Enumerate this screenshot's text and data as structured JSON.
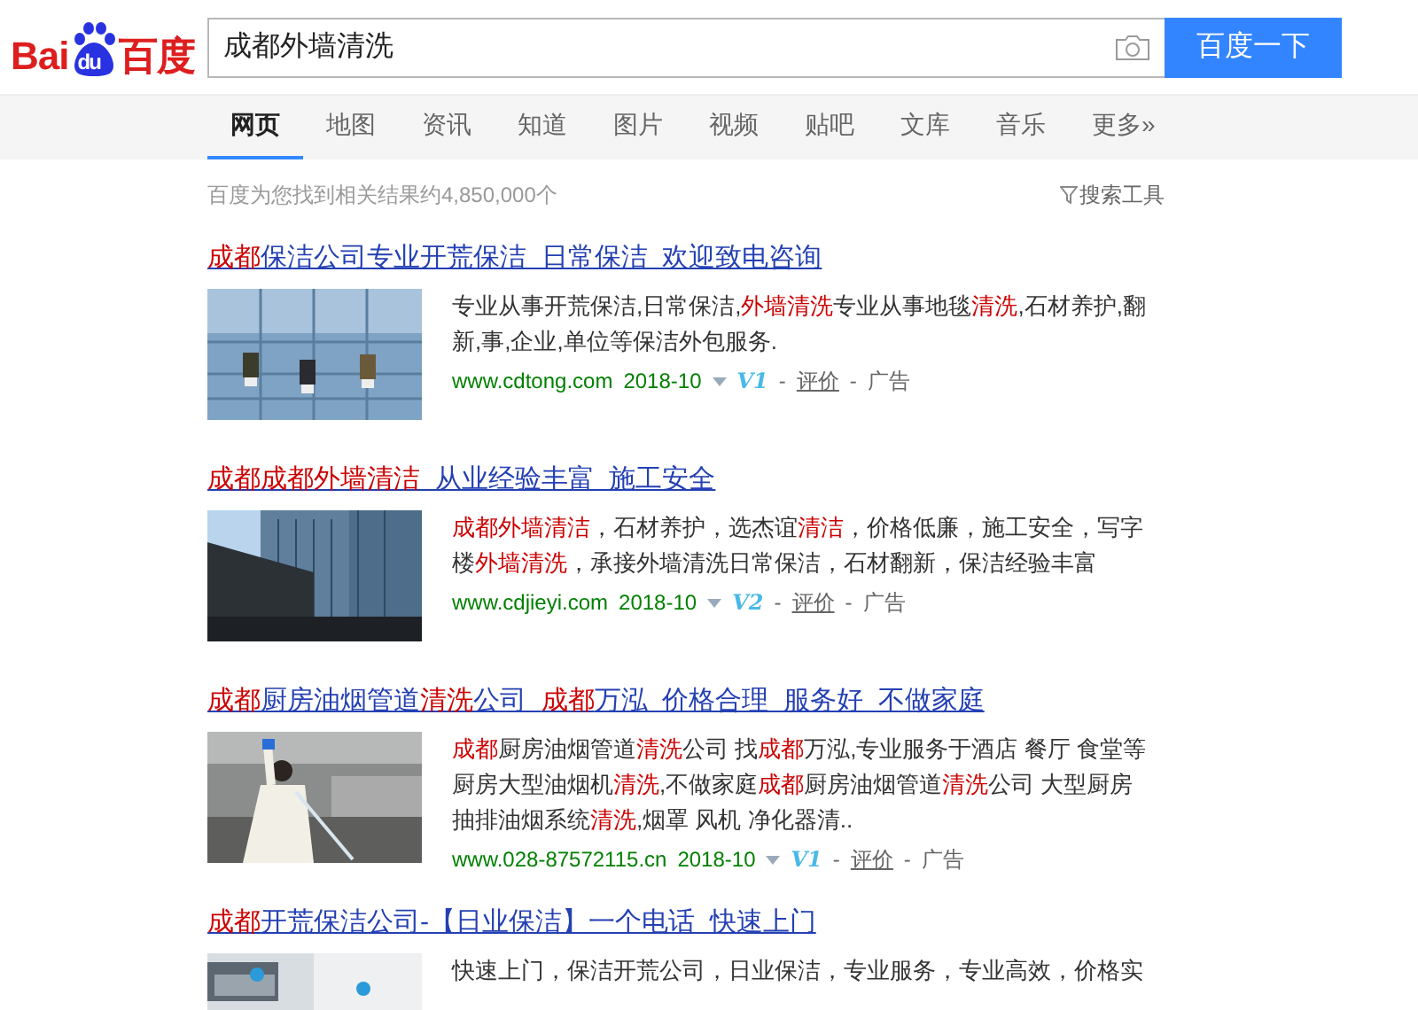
{
  "logo": {
    "left": "Bai",
    "paw": "du",
    "right": "百度"
  },
  "search": {
    "value": "成都外墙清洗",
    "button": "百度一下"
  },
  "tabs": [
    {
      "label": "网页",
      "selected": true
    },
    {
      "label": "地图",
      "selected": false
    },
    {
      "label": "资讯",
      "selected": false
    },
    {
      "label": "知道",
      "selected": false
    },
    {
      "label": "图片",
      "selected": false
    },
    {
      "label": "视频",
      "selected": false
    },
    {
      "label": "贴吧",
      "selected": false
    },
    {
      "label": "文库",
      "selected": false
    },
    {
      "label": "音乐",
      "selected": false
    },
    {
      "label": "更多»",
      "selected": false
    }
  ],
  "result_count": "百度为您找到相关结果约4,850,000个",
  "search_tools": "搜索工具",
  "results": [
    {
      "title": [
        {
          "text": "成都",
          "hit": true
        },
        {
          "text": "保洁公司专业开荒保洁  日常保洁  欢迎致电咨询",
          "hit": false
        }
      ],
      "description": [
        {
          "text": "专业从事开荒保洁,日常保洁,",
          "hit": false
        },
        {
          "text": "外墙清洗",
          "hit": true
        },
        {
          "text": "专业从事地毯",
          "hit": false
        },
        {
          "text": "清洗",
          "hit": true
        },
        {
          "text": ",石材养护,翻新,事,企业,单位等保洁外包服务.",
          "hit": false
        }
      ],
      "meta": {
        "url": "www.cdtong.com",
        "date": "2018-10",
        "badge": "V1",
        "sep_1": "-",
        "rating": "评价",
        "sep_2": "-",
        "ad": "广告"
      }
    },
    {
      "title": [
        {
          "text": "成都成都外墙清洁",
          "hit": true
        },
        {
          "text": "  从业经验丰富  施工安全",
          "hit": false
        }
      ],
      "description": [
        {
          "text": "成都外墙清洁",
          "hit": true
        },
        {
          "text": "，石材养护，选杰谊",
          "hit": false
        },
        {
          "text": "清洁",
          "hit": true
        },
        {
          "text": "，价格低廉，施工安全，写字楼",
          "hit": false
        },
        {
          "text": "外墙清洗",
          "hit": true
        },
        {
          "text": "，承接外墙清洗日常保洁，石材翻新，保洁经验丰富",
          "hit": false
        }
      ],
      "meta": {
        "url": "www.cdjieyi.com",
        "date": "2018-10",
        "badge": "V2",
        "sep_1": "-",
        "rating": "评价",
        "sep_2": "-",
        "ad": "广告"
      }
    },
    {
      "title": [
        {
          "text": "成都",
          "hit": true
        },
        {
          "text": "厨房油烟管道",
          "hit": false
        },
        {
          "text": "清洗",
          "hit": true
        },
        {
          "text": "公司  ",
          "hit": false
        },
        {
          "text": "成都",
          "hit": true
        },
        {
          "text": "万泓  价格合理  服务好  不做家庭",
          "hit": false
        }
      ],
      "description": [
        {
          "text": "成都",
          "hit": true
        },
        {
          "text": "厨房油烟管道",
          "hit": false
        },
        {
          "text": "清洗",
          "hit": true
        },
        {
          "text": "公司 找",
          "hit": false
        },
        {
          "text": "成都",
          "hit": true
        },
        {
          "text": "万泓,专业服务于酒店 餐厅 食堂等厨房大型油烟机",
          "hit": false
        },
        {
          "text": "清洗",
          "hit": true
        },
        {
          "text": ",不做家庭",
          "hit": false
        },
        {
          "text": "成都",
          "hit": true
        },
        {
          "text": "厨房油烟管道",
          "hit": false
        },
        {
          "text": "清洗",
          "hit": true
        },
        {
          "text": "公司 大型厨房抽排油烟系统",
          "hit": false
        },
        {
          "text": "清洗",
          "hit": true
        },
        {
          "text": ",烟罩 风机 净化器清..",
          "hit": false
        }
      ],
      "meta": {
        "url": "www.028-87572115.cn",
        "date": "2018-10",
        "badge": "V1",
        "sep_1": "-",
        "rating": "评价",
        "sep_2": "-",
        "ad": "广告"
      }
    },
    {
      "title": [
        {
          "text": "成都",
          "hit": true
        },
        {
          "text": "开荒保洁公司-【日业保洁】一个电话  快速上门",
          "hit": false
        }
      ],
      "description": [
        {
          "text": "快速上门，保洁开荒公司，日业保洁，专业服务，专业高效，价格实",
          "hit": false
        }
      ]
    }
  ]
}
